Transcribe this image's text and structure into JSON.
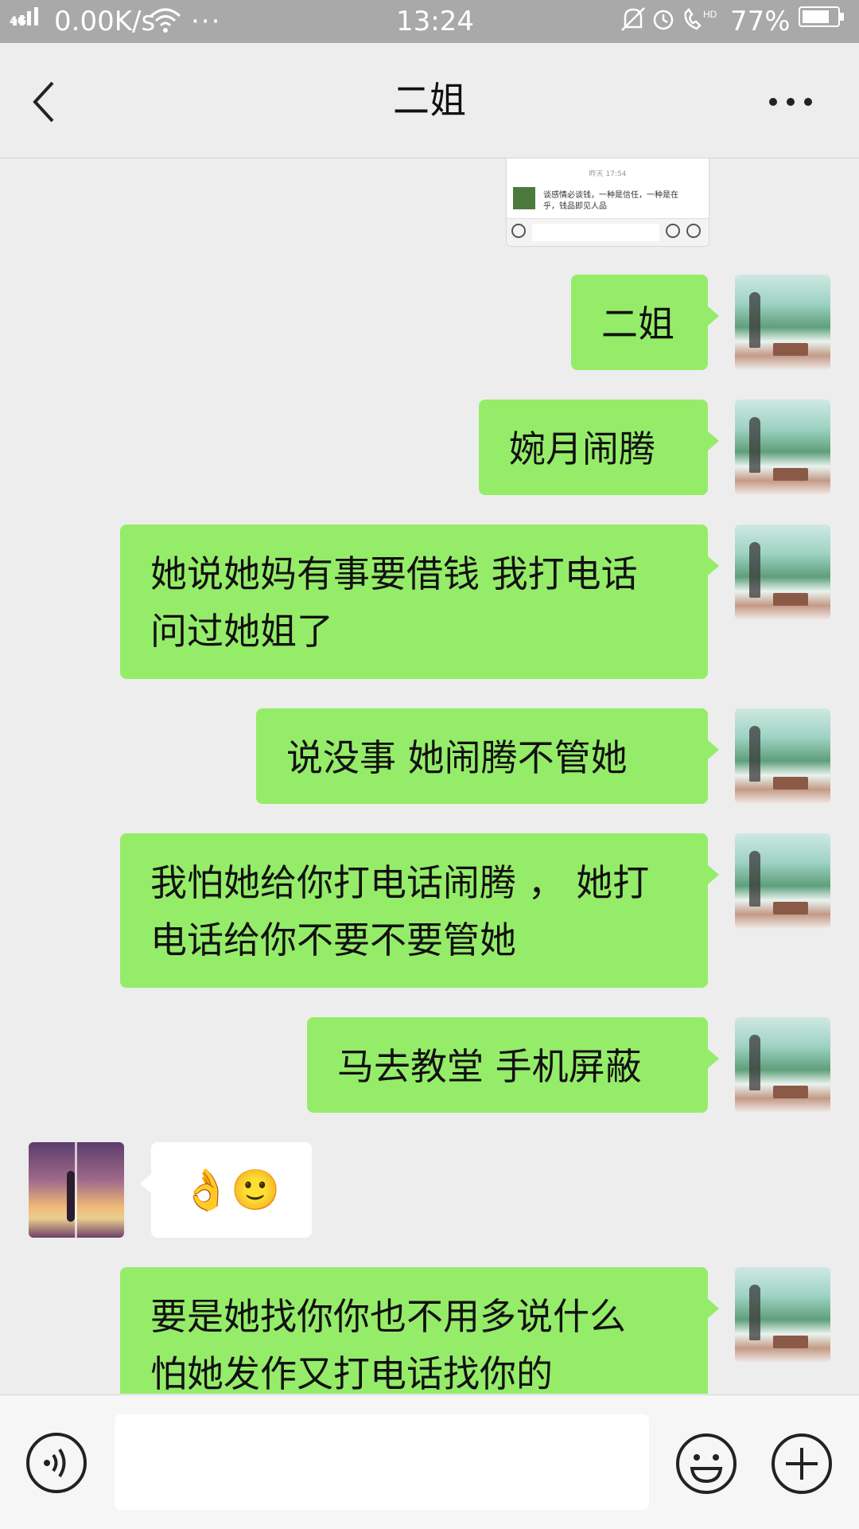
{
  "status_bar": {
    "network": "4G",
    "speed": "0.00K/s",
    "more": "···",
    "time": "13:24",
    "hd": "HD",
    "battery": "77%"
  },
  "nav": {
    "title": "二姐",
    "back_icon": "chevron-left-icon",
    "more_icon": "more-dots-icon"
  },
  "screenshot_attachment": {
    "timestamp": "昨天 17:54",
    "preview_text": "谈感情必谈钱，一种是信任，一种是在乎，钱品即见人品"
  },
  "messages": [
    {
      "from": "me",
      "text": "二姐"
    },
    {
      "from": "me",
      "text": "婉月闹腾"
    },
    {
      "from": "me",
      "lines": [
        "她说她妈有事要借钱 我打电话",
        "问过她姐了"
      ]
    },
    {
      "from": "me",
      "text": "说没事 她闹腾不管她"
    },
    {
      "from": "me",
      "lines": [
        "我怕她给你打电话闹腾 ， 她打",
        "电话给你不要不要管她"
      ]
    },
    {
      "from": "me",
      "text": "马去教堂 手机屏蔽"
    },
    {
      "from": "her",
      "text": "👌🙂"
    },
    {
      "from": "me",
      "lines": [
        "要是她找你你也不用多说什么",
        "怕她发作又打电话找你的"
      ]
    }
  ],
  "input_bar": {
    "value": "",
    "voice_icon": "voice-icon",
    "emoji_icon": "emoji-icon",
    "plus_icon": "plus-icon"
  },
  "colors": {
    "outgoing_bubble": "#95ec69",
    "incoming_bubble": "#ffffff",
    "background": "#ededed",
    "status_bar": "#a9a9a9"
  }
}
